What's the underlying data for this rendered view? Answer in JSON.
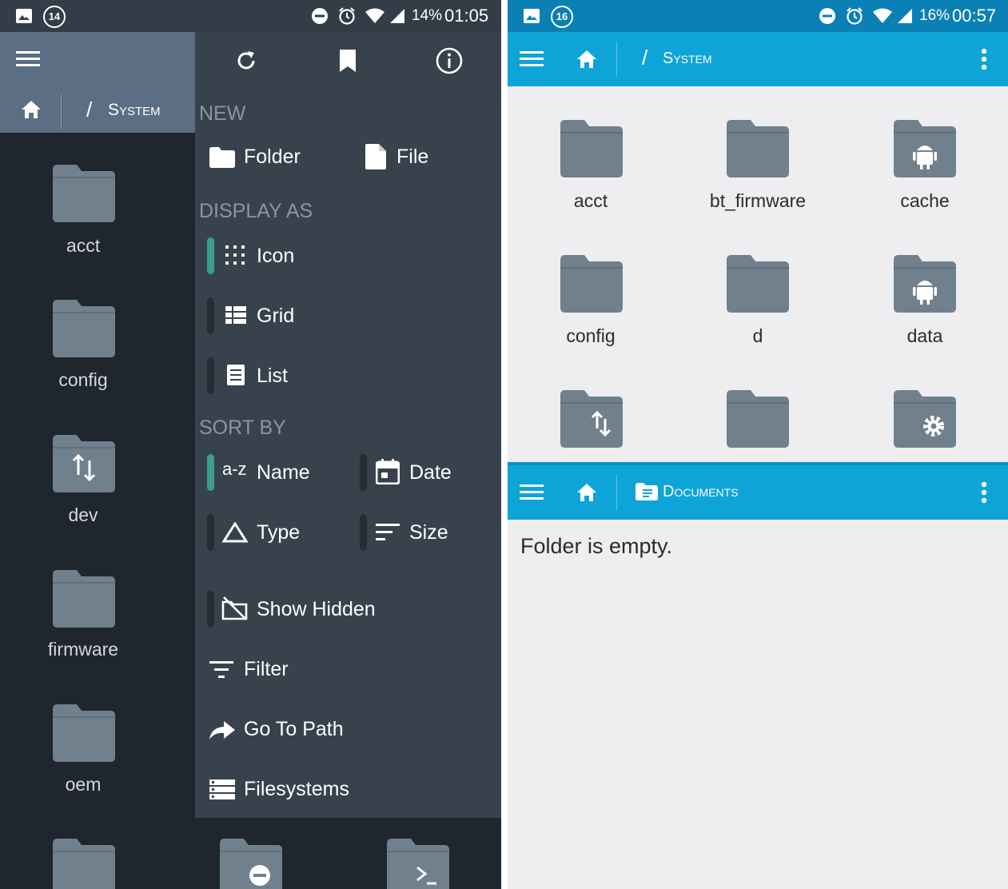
{
  "left_screen": {
    "status": {
      "notif_count": "14",
      "battery": "14%",
      "time": "01:05"
    },
    "breadcrumb": {
      "separator": "/",
      "path": "System"
    },
    "menu": {
      "new_header": "NEW",
      "new_items": [
        "Folder",
        "File"
      ],
      "display_header": "DISPLAY AS",
      "display_items": [
        "Icon",
        "Grid",
        "List"
      ],
      "display_selected": "Icon",
      "sort_header": "SORT BY",
      "sort_items": [
        "Name",
        "Date",
        "Type",
        "Size"
      ],
      "sort_selected": "Name",
      "sort_icon_text": "a-z",
      "show_hidden": "Show Hidden",
      "filter": "Filter",
      "go_to_path": "Go To Path",
      "filesystems": "Filesystems"
    },
    "folders": [
      {
        "name": "acct",
        "badge": ""
      },
      {
        "name": "config",
        "badge": ""
      },
      {
        "name": "dev",
        "badge": "arrows-updown-icon"
      },
      {
        "name": "firmware",
        "badge": ""
      },
      {
        "name": "oem",
        "badge": ""
      }
    ],
    "bottom_row_badges": [
      "",
      "minus-circle-icon",
      "terminal-icon"
    ]
  },
  "right_screen": {
    "status": {
      "notif_count": "16",
      "battery": "16%",
      "time": "00:57"
    },
    "pane1": {
      "separator": "/",
      "title": "System",
      "folders": [
        {
          "name": "acct",
          "badge": ""
        },
        {
          "name": "bt_firmware",
          "badge": ""
        },
        {
          "name": "cache",
          "badge": "android-icon"
        },
        {
          "name": "config",
          "badge": ""
        },
        {
          "name": "d",
          "badge": ""
        },
        {
          "name": "data",
          "badge": "android-icon"
        }
      ],
      "partial_row_badges": [
        "arrows-updown-icon",
        "",
        "gear-icon"
      ]
    },
    "pane2": {
      "title": "Documents",
      "empty_message": "Folder is empty."
    }
  },
  "colors": {
    "left_status": "#323d48",
    "left_appbar": "#5b6e84",
    "left_menu": "#37424d",
    "left_bg": "#1f262e",
    "indicator_active": "#3a9d8f",
    "right_status": "#0b80b4",
    "right_appbar": "#0ea4d8",
    "right_bg": "#eeeef0",
    "folder_fill": "#70808d"
  }
}
